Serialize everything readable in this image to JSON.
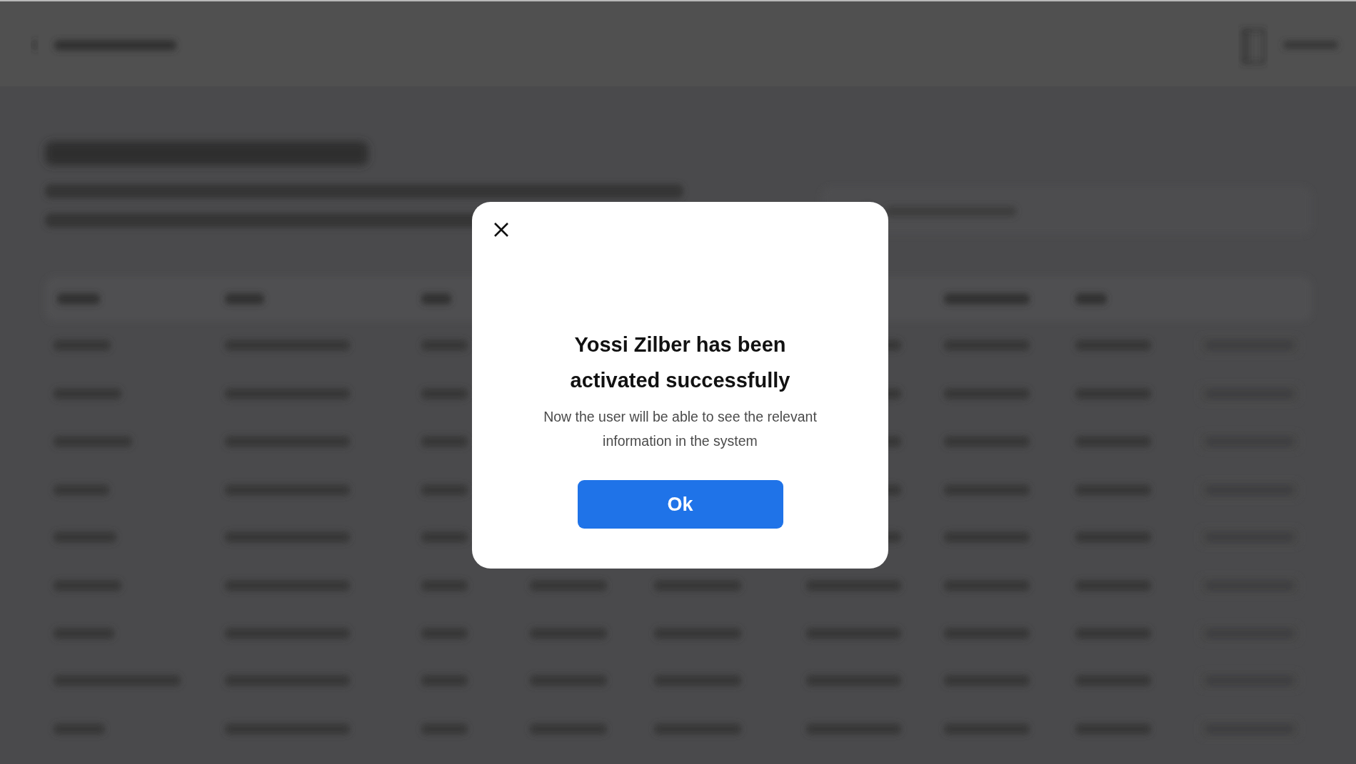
{
  "dialog": {
    "title": "Yossi Zilber has been activated successfully",
    "message": "Now the user will be able to see the relevant information in the system",
    "button": "Ok"
  }
}
